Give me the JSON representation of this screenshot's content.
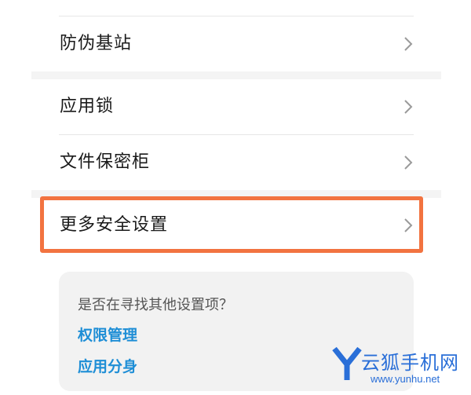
{
  "settings": {
    "rows": [
      {
        "label": "防伪基站"
      },
      {
        "label": "应用锁"
      },
      {
        "label": "文件保密柜"
      },
      {
        "label": "更多安全设置"
      }
    ],
    "highlighted_row": "更多安全设置"
  },
  "hint_card": {
    "question": "是否在寻找其他设置项？",
    "links": [
      {
        "label": "权限管理"
      },
      {
        "label": "应用分身"
      }
    ]
  },
  "watermark": {
    "letter": "Y",
    "title": "云狐手机网",
    "url": "www.yunhu.net"
  },
  "icons": {
    "row_chevron": "chevron-right-icon"
  },
  "colors": {
    "highlight": "#f27340",
    "link": "#1e8ed6",
    "watermark": "#2a6fd8"
  }
}
